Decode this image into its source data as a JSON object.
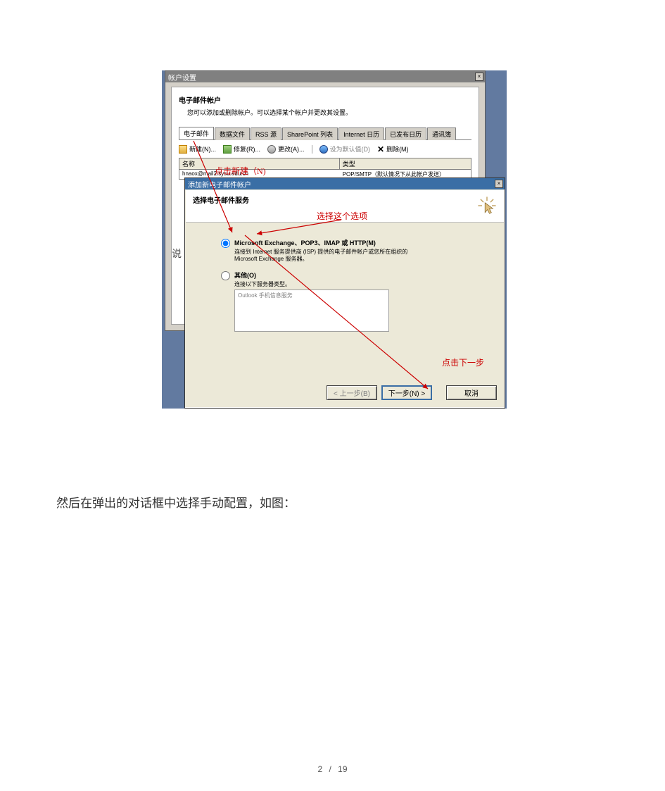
{
  "win_back": {
    "title": "帐户设置",
    "heading": "电子邮件帐户",
    "subheading": "您可以添加或删除帐户。可以选择某个帐户并更改其设置。",
    "tabs": [
      "电子邮件",
      "数据文件",
      "RSS 源",
      "SharePoint 列表",
      "Internet 日历",
      "已发布日历",
      "通讯簿"
    ],
    "toolbar": {
      "new": "新建(N)...",
      "repair": "修复(R)...",
      "change": "更改(A)...",
      "set_default": "设为默认值(D)",
      "delete": "删除(M)"
    },
    "table": {
      "col_name": "名称",
      "col_type": "类型",
      "row": {
        "name": "hnaox@mail2.sysu.edu.cn",
        "type": "POP/SMTP（默认情况下从此帐户发送）"
      }
    }
  },
  "win_front": {
    "title": "添加新电子邮件帐户",
    "heading": "选择电子邮件服务",
    "opt1_label": "Microsoft Exchange、POP3、IMAP 或 HTTP(M)",
    "opt1_desc1": "连接到 Internet 服务提供商 (ISP) 提供的电子邮件帐户或您所在组织的",
    "opt1_desc2": "Microsoft Exchange 服务器。",
    "opt2_label": "其他(O)",
    "opt2_desc": "连接以下服务器类型。",
    "opt2_box": "Outlook 手机信息服务",
    "btn_back": "< 上一步(B)",
    "btn_next": "下一步(N) >",
    "btn_cancel": "取消"
  },
  "junk_letter": "说",
  "annotations": {
    "click_new": "点击新建（N)",
    "choose_option": "选择这个选项",
    "click_next": "点击下一步"
  },
  "body_text": "然后在弹出的对话框中选择手动配置，如图：",
  "page": {
    "current": "2",
    "sep": "/",
    "total": "19"
  }
}
